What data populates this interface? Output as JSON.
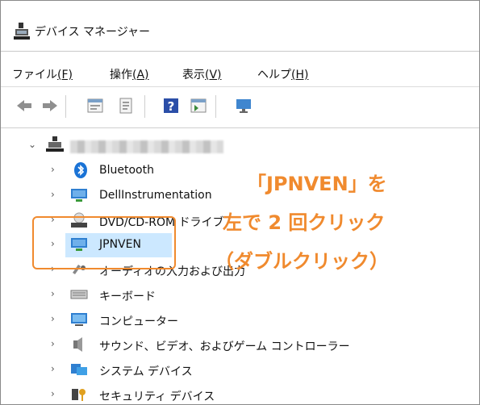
{
  "window": {
    "title": "デバイス マネージャー"
  },
  "menu": [
    {
      "label": "ファイル",
      "key": "(F)"
    },
    {
      "label": "操作",
      "key": "(A)"
    },
    {
      "label": "表示",
      "key": "(V)"
    },
    {
      "label": "ヘルプ",
      "key": "(H)"
    }
  ],
  "toolbar": {
    "icons": [
      "back-icon",
      "forward-icon",
      "properties-panel-icon",
      "properties-sheet-icon",
      "help-icon",
      "show-hidden-icon",
      "monitor-scan-icon"
    ]
  },
  "tree": {
    "items": [
      {
        "label": "Bluetooth"
      },
      {
        "label": "DellInstrumentation"
      },
      {
        "label": "DVD/CD-ROM ドライブ"
      },
      {
        "label": "JPNVEN"
      },
      {
        "label": "オーディオの入力および出力"
      },
      {
        "label": "キーボード"
      },
      {
        "label": "コンピューター"
      },
      {
        "label": "サウンド、ビデオ、およびゲーム コントローラー"
      },
      {
        "label": "システム デバイス"
      },
      {
        "label": "セキュリティ デバイス"
      }
    ]
  },
  "annotation": {
    "line1": "「JPNVEN」を",
    "line2": "左で 2 回クリック",
    "line3": "（ダブルクリック）",
    "color": "#f08a2e"
  }
}
